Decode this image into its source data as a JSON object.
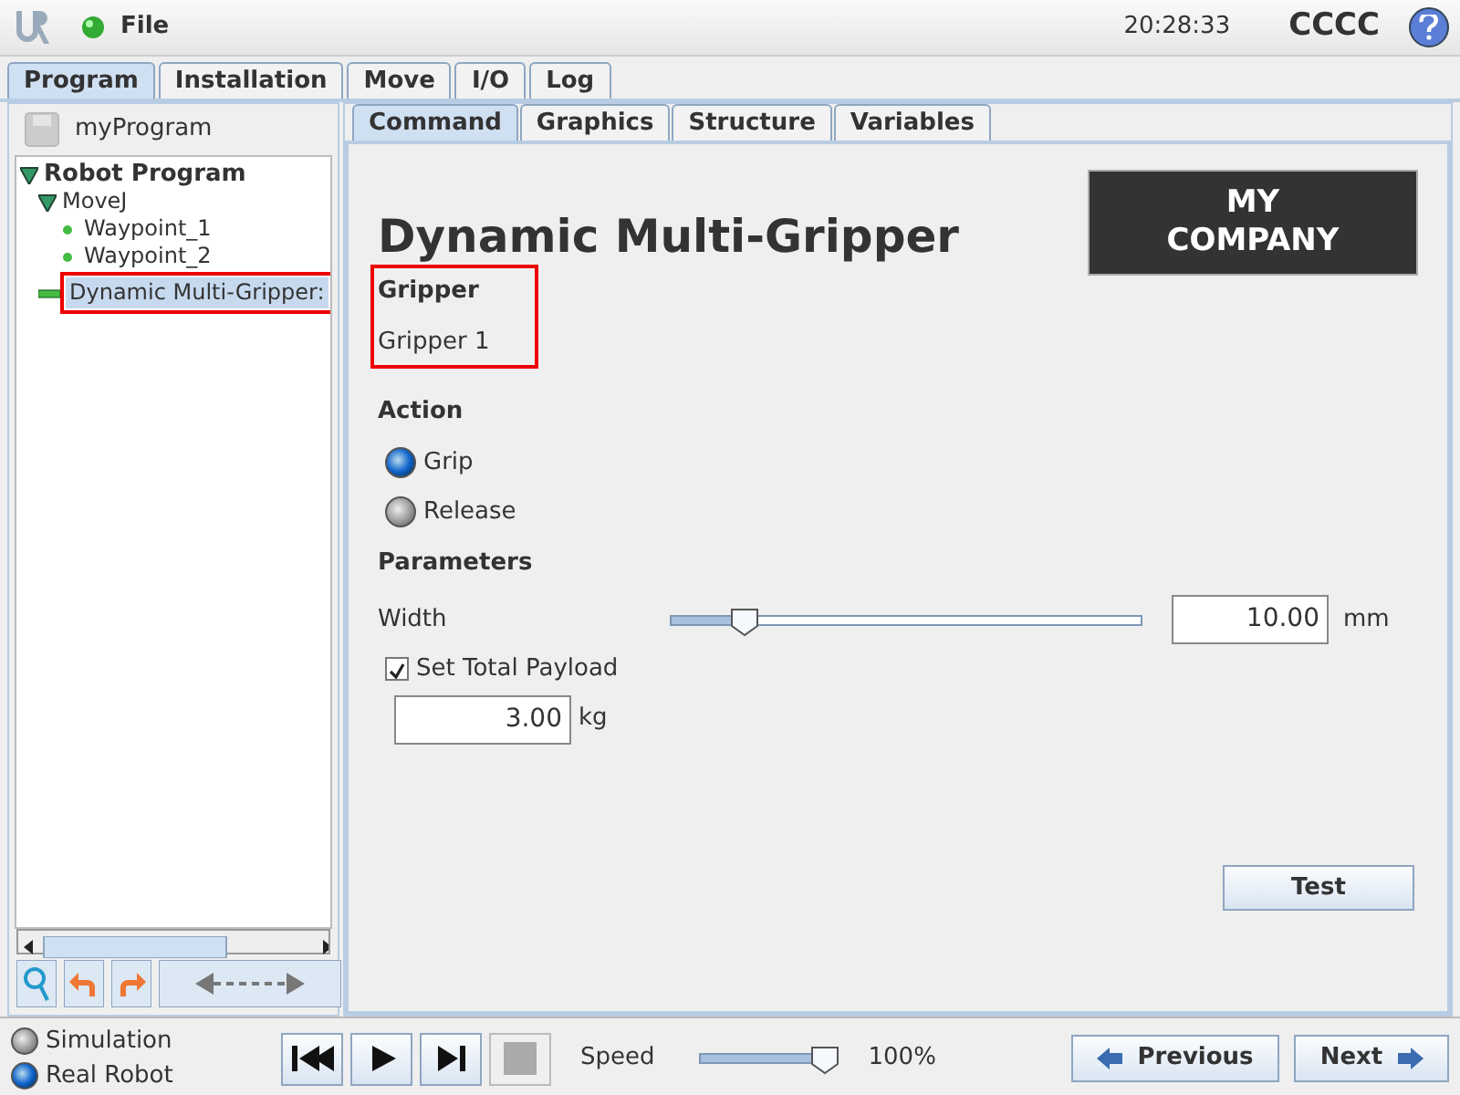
{
  "header": {
    "menu": "File",
    "time": "20:28:33",
    "robot_name": "CCCC"
  },
  "main_tabs": [
    {
      "label": "Program",
      "selected": true
    },
    {
      "label": "Installation",
      "selected": false
    },
    {
      "label": "Move",
      "selected": false
    },
    {
      "label": "I/O",
      "selected": false
    },
    {
      "label": "Log",
      "selected": false
    }
  ],
  "program_name": "myProgram",
  "tree": [
    {
      "label": "Robot Program",
      "bold": true,
      "selected": false,
      "highlighted": false,
      "children": [
        {
          "label": "MoveJ",
          "bold": false,
          "selected": false,
          "highlighted": false,
          "children": [
            {
              "label": "Waypoint_1",
              "bold": false,
              "selected": false,
              "highlighted": false
            },
            {
              "label": "Waypoint_2",
              "bold": false,
              "selected": false,
              "highlighted": false
            }
          ]
        },
        {
          "label": "Dynamic Multi-Gripper:",
          "bold": false,
          "selected": true,
          "highlighted": true
        }
      ]
    }
  ],
  "sub_tabs": [
    {
      "label": "Command",
      "selected": true
    },
    {
      "label": "Graphics",
      "selected": false
    },
    {
      "label": "Structure",
      "selected": false
    },
    {
      "label": "Variables",
      "selected": false
    }
  ],
  "command": {
    "title": "Dynamic Multi-Gripper",
    "logo": [
      "MY",
      "COMPANY"
    ],
    "gripper": {
      "heading": "Gripper",
      "value": "Gripper 1",
      "highlighted": true
    },
    "action": {
      "heading": "Action",
      "options": [
        {
          "label": "Grip",
          "selected": true
        },
        {
          "label": "Release",
          "selected": false
        }
      ]
    },
    "parameters": {
      "heading": "Parameters",
      "width_label": "Width",
      "width_slider": {
        "level": 0.16
      },
      "width_value": "10.00",
      "width_unit": "mm",
      "payload_label": "Set Total Payload",
      "payload_checked": true,
      "payload_value": "3.00",
      "payload_unit": "kg"
    },
    "test_button": "Test"
  },
  "footer": {
    "modes": [
      {
        "label": "Simulation",
        "selected": false
      },
      {
        "label": "Real Robot",
        "selected": true
      }
    ],
    "speed_label": "Speed",
    "speed_slider": {
      "level": 1.0
    },
    "speed_value": "100%",
    "previous": "Previous",
    "next": "Next"
  }
}
